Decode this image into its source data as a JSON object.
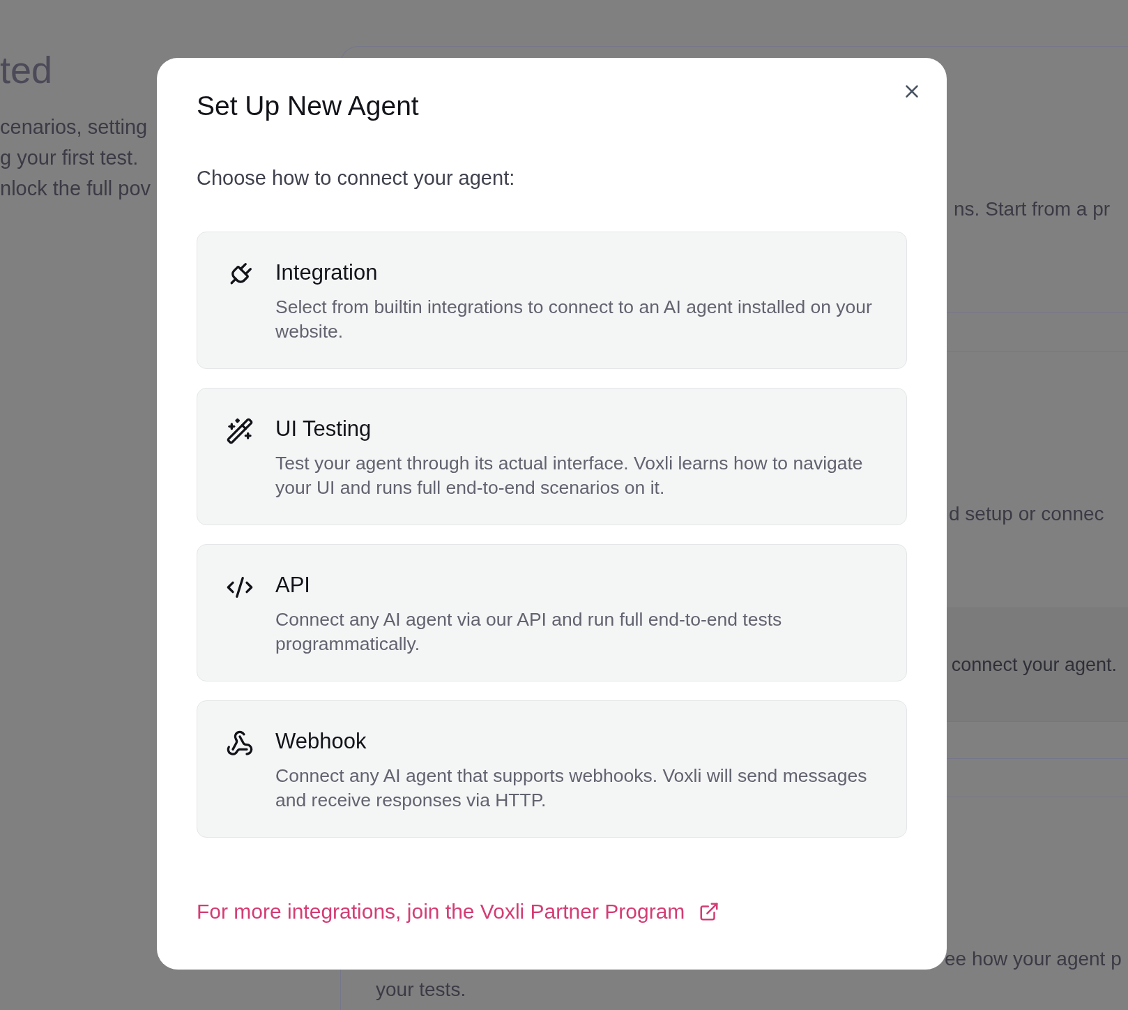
{
  "background": {
    "heading": "ted",
    "intro_lines": [
      "cenarios, setting",
      "g your first test.",
      "nlock the full pov"
    ],
    "panel": {
      "line_1": "ns. Start from a pr",
      "line_2": "d setup or connec",
      "highlight": "connect your agent.",
      "footer_lines": [
        "ee how your agent p",
        "your tests."
      ]
    }
  },
  "dialog": {
    "title": "Set Up New Agent",
    "subtitle": "Choose how to connect your agent:",
    "options": [
      {
        "kind": "integration",
        "title": "Integration",
        "description": "Select from builtin integrations to connect to an AI agent installed on your website."
      },
      {
        "kind": "ui",
        "title": "UI Testing",
        "description": "Test your agent through its actual interface. Voxli learns how to navigate your UI and runs full end-to-end scenarios on it."
      },
      {
        "kind": "api",
        "title": "API",
        "description": "Connect any AI agent via our API and run full end-to-end tests programmatically."
      },
      {
        "kind": "webhook",
        "title": "Webhook",
        "description": "Connect any AI agent that supports webhooks. Voxli will send messages and receive responses via HTTP."
      }
    ],
    "partner_link": "For more integrations, join the Voxli Partner Program"
  }
}
